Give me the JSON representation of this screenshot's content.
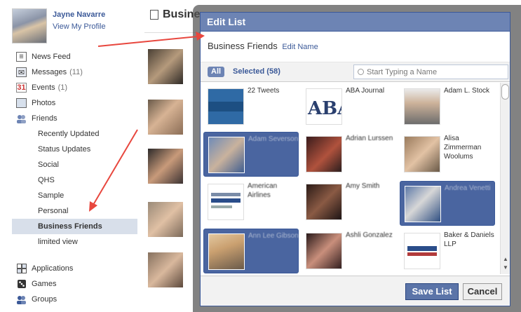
{
  "profile": {
    "name": "Jayne Navarre",
    "link": "View My Profile"
  },
  "nav": {
    "main": [
      {
        "label": "News Feed",
        "count": "",
        "icon": "news-feed-icon"
      },
      {
        "label": "Messages",
        "count": "(11)",
        "icon": "messages-icon"
      },
      {
        "label": "Events",
        "count": "(1)",
        "icon": "events-icon"
      },
      {
        "label": "Photos",
        "count": "",
        "icon": "photos-icon"
      },
      {
        "label": "Friends",
        "count": "",
        "icon": "friends-icon"
      }
    ],
    "friend_lists": [
      "Recently Updated",
      "Status Updates",
      "Social",
      "QHS",
      "Sample",
      "Personal",
      "Business Friends",
      "limited view"
    ],
    "active_list": "Business Friends",
    "apps": [
      {
        "label": "Applications",
        "icon": "applications-icon"
      },
      {
        "label": "Games",
        "icon": "games-icon"
      },
      {
        "label": "Groups",
        "icon": "groups-icon"
      }
    ]
  },
  "feed": {
    "title": "Busine"
  },
  "dialog": {
    "title": "Edit List",
    "list_name": "Business Friends",
    "edit_name": "Edit Name",
    "tab_all": "All",
    "tab_selected": "Selected (58)",
    "search_placeholder": "Start Typing a Name",
    "save": "Save List",
    "cancel": "Cancel",
    "friends": [
      {
        "name": "22 Tweets",
        "selected": false,
        "blur": false
      },
      {
        "name": "ABA Journal",
        "selected": false,
        "blur": false
      },
      {
        "name": "Adam L. Stock",
        "selected": false,
        "blur": false
      },
      {
        "name": "Adam Severson",
        "selected": true,
        "blur": true
      },
      {
        "name": "Adrian Lurssen",
        "selected": false,
        "blur": true
      },
      {
        "name": "Alisa Zimmerman Woolums",
        "selected": false,
        "blur": false
      },
      {
        "name": "American Airlines",
        "selected": false,
        "blur": true
      },
      {
        "name": "Amy Smith",
        "selected": false,
        "blur": true
      },
      {
        "name": "Andrea Venetti",
        "selected": true,
        "blur": true
      },
      {
        "name": "Ann Lee Gibson",
        "selected": true,
        "blur": true
      },
      {
        "name": "Ashli Gonzalez",
        "selected": false,
        "blur": true
      },
      {
        "name": "Baker & Daniels LLP",
        "selected": false,
        "blur": false
      }
    ]
  },
  "colors": {
    "brand": "#3b5998",
    "header": "#6d84b4",
    "selected_bg": "#4a65a0",
    "arrow": "#e8473e"
  }
}
